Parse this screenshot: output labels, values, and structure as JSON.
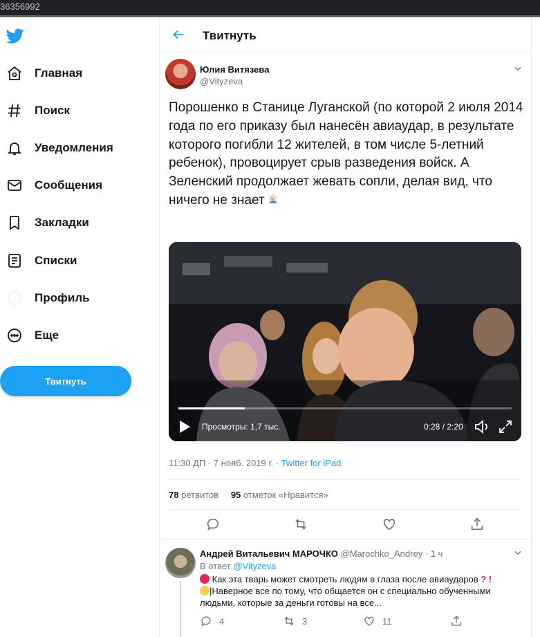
{
  "browser": {
    "fragment": "36356992"
  },
  "sidebar": {
    "items": [
      {
        "label": "Главная",
        "icon": "home-icon"
      },
      {
        "label": "Поиск",
        "icon": "hashtag-icon"
      },
      {
        "label": "Уведомления",
        "icon": "bell-icon"
      },
      {
        "label": "Сообщения",
        "icon": "mail-icon"
      },
      {
        "label": "Закладки",
        "icon": "bookmark-icon"
      },
      {
        "label": "Списки",
        "icon": "list-icon"
      },
      {
        "label": "Профиль",
        "icon": "profile-icon"
      },
      {
        "label": "Еще",
        "icon": "more-icon"
      }
    ],
    "tweet_button": "Твитнуть"
  },
  "header": {
    "title": "Твитнуть"
  },
  "tweet": {
    "author_name": "Юлия Витязева",
    "author_handle": "@Vityzeva",
    "text": "Порошенко в Станице Луганской (по которой 2 июля 2014 года по его приказу был нанесён авиаудар, в результате которого погибли 12 жителей, в том числе 5-летний ребенок), провоцирует срыв разведения войск. А Зеленский продолжает жевать сопли, делая вид, что ничего не знает",
    "video": {
      "views": "Просмотры: 1,7 тыс.",
      "time": "0:28 / 2:20",
      "progress": 0.2
    },
    "timestamp": "11:30 ДП · 7 нояб. 2019 г. · ",
    "source": "Twitter for iPad",
    "retweets": "78",
    "retweets_label": "ретвитов",
    "likes": "95",
    "likes_label": "отметок «Нравится»"
  },
  "reply": {
    "name": "Андрей Витальевич МАРОЧКО",
    "handle": "@Marochko_Andrey",
    "sep": " · ",
    "time": "1 ч",
    "reply_prefix": "В ответ ",
    "reply_to": "@Vityzeva",
    "line1": "Как эта тварь может смотреть людям в глаза после авиаударов",
    "line2": "|Наверное все по тому, что общается он с специально обученными людьми, которые за деньги готовы на все...",
    "counts": {
      "replies": "4",
      "retweets": "3",
      "likes": "11"
    }
  },
  "colors": {
    "accent": "#1da1f2",
    "text": "#14171a",
    "secondary": "#657786",
    "border": "#e6ecf0"
  }
}
